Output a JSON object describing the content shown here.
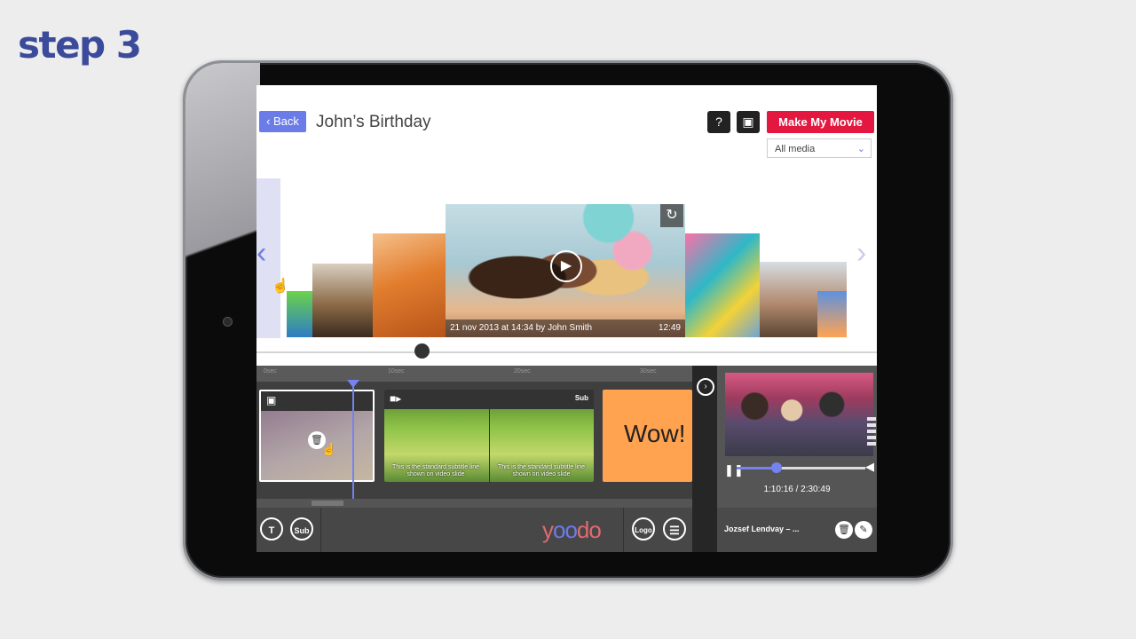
{
  "step_label": "step 3",
  "header": {
    "back_label": "Back",
    "title": "John’s Birthday",
    "help_icon": "?",
    "camera_icon": "camera-icon",
    "make_movie_label": "Make My Movie",
    "media_filter": {
      "selected": "All media"
    }
  },
  "carousel": {
    "main_caption_left": "21 nov 2013 at 14:34 by John Smith",
    "main_caption_right": "12:49"
  },
  "timeline": {
    "ruler_ticks": [
      "0sec",
      "10sec",
      "20sec",
      "30sec"
    ],
    "clip_b_sub_label": "Sub",
    "subtitle_text": "This is the standard subtitle line shown on video slide",
    "text_clip": "Wow!",
    "playhead_fraction": 0.22
  },
  "toolbar": {
    "text_button": "T",
    "sub_button": "Sub",
    "logo_text_1": "y",
    "logo_text_2": "oo",
    "logo_text_3": "do",
    "logo_button": "Logo"
  },
  "preview": {
    "time": "1:10:16 / 2:30:49",
    "progress_fraction": 0.31,
    "author": "Jozsef Lendvay – ..."
  },
  "colors": {
    "accent": "#6b7ce8",
    "make_movie": "#e3173f",
    "text_clip_bg": "#ffa350",
    "brand_title": "#3b4a9a"
  }
}
